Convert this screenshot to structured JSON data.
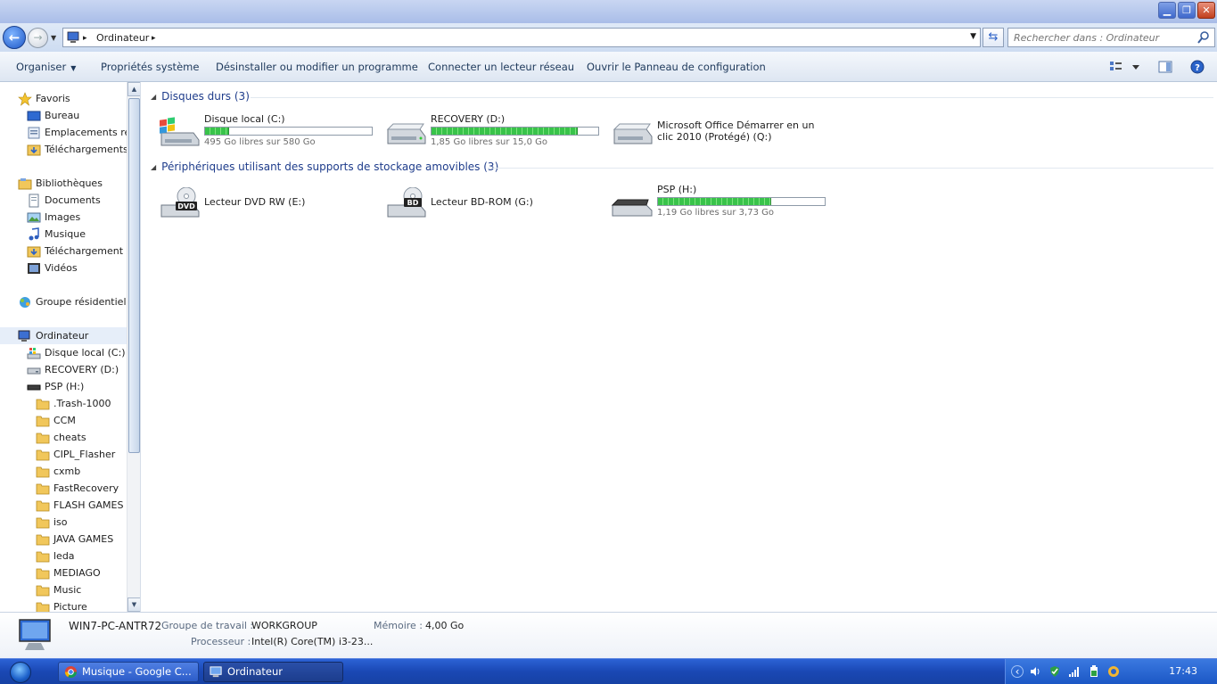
{
  "window": {
    "controls": {
      "minimize": "▁",
      "maximize": "❐",
      "close": "✕"
    }
  },
  "address": {
    "crumb": "Ordinateur",
    "separator": "▸",
    "search_placeholder": "Rechercher dans : Ordinateur"
  },
  "toolbar": {
    "organize": "Organiser",
    "system_props": "Propriétés système",
    "uninstall": "Désinstaller ou modifier un programme",
    "map_drive": "Connecter un lecteur réseau",
    "control_panel": "Ouvrir le Panneau de configuration"
  },
  "nav": {
    "favorites": "Favoris",
    "fav_items": [
      "Bureau",
      "Emplacements réce",
      "Téléchargements"
    ],
    "libraries": "Bibliothèques",
    "lib_items": [
      "Documents",
      "Images",
      "Musique",
      "Téléchargement",
      "Vidéos"
    ],
    "homegroup": "Groupe résidentiel",
    "computer": "Ordinateur",
    "drives": [
      "Disque local (C:)",
      "RECOVERY (D:)",
      "PSP (H:)"
    ],
    "psp_folders": [
      ".Trash-1000",
      "CCM",
      "cheats",
      "CIPL_Flasher",
      "cxmb",
      "FastRecovery",
      "FLASH GAMES",
      "iso",
      "JAVA GAMES",
      "leda",
      "MEDIAGO",
      "Music",
      "Picture"
    ]
  },
  "content": {
    "hard_disks_header": "Disques durs (3)",
    "removable_header": "Périphériques utilisant des supports de stockage amovibles (3)",
    "hard_disks": [
      {
        "name": "Disque local (C:)",
        "free": "495 Go libres sur 580 Go",
        "used_fraction": 0.147,
        "icon": "windows-drive-icon"
      },
      {
        "name": "RECOVERY (D:)",
        "free": "1,85 Go libres sur 15,0 Go",
        "used_fraction": 0.877,
        "icon": "hard-drive-icon"
      },
      {
        "name": "Microsoft Office Démarrer en un clic 2010 (Protégé) (Q:)",
        "icon": "hard-drive-icon"
      }
    ],
    "removable": [
      {
        "name": "Lecteur DVD RW (E:)",
        "icon": "dvd-drive-icon",
        "badge": "DVD"
      },
      {
        "name": "Lecteur BD-ROM (G:)",
        "icon": "bd-drive-icon",
        "badge": "BD"
      },
      {
        "name": "PSP (H:)",
        "free": "1,19 Go libres sur 3,73 Go",
        "used_fraction": 0.681,
        "icon": "removable-drive-icon"
      }
    ]
  },
  "details": {
    "computer_name": "WIN7-PC-ANTR72",
    "workgroup_label": "Groupe de travail :",
    "workgroup_value": "WORKGROUP",
    "memory_label": "Mémoire :",
    "memory_value": "4,00 Go",
    "processor_label": "Processeur :",
    "processor_value": "Intel(R) Core(TM) i3-23..."
  },
  "taskbar": {
    "tasks": [
      {
        "label": "Musique - Google C...",
        "icon": "chrome-icon"
      },
      {
        "label": "Ordinateur",
        "icon": "computer-icon"
      }
    ],
    "clock": "17:43"
  },
  "colors": {
    "accent": "#1e3c8b",
    "progress_green": "#39c34a",
    "taskbar": "#1a48b4"
  }
}
